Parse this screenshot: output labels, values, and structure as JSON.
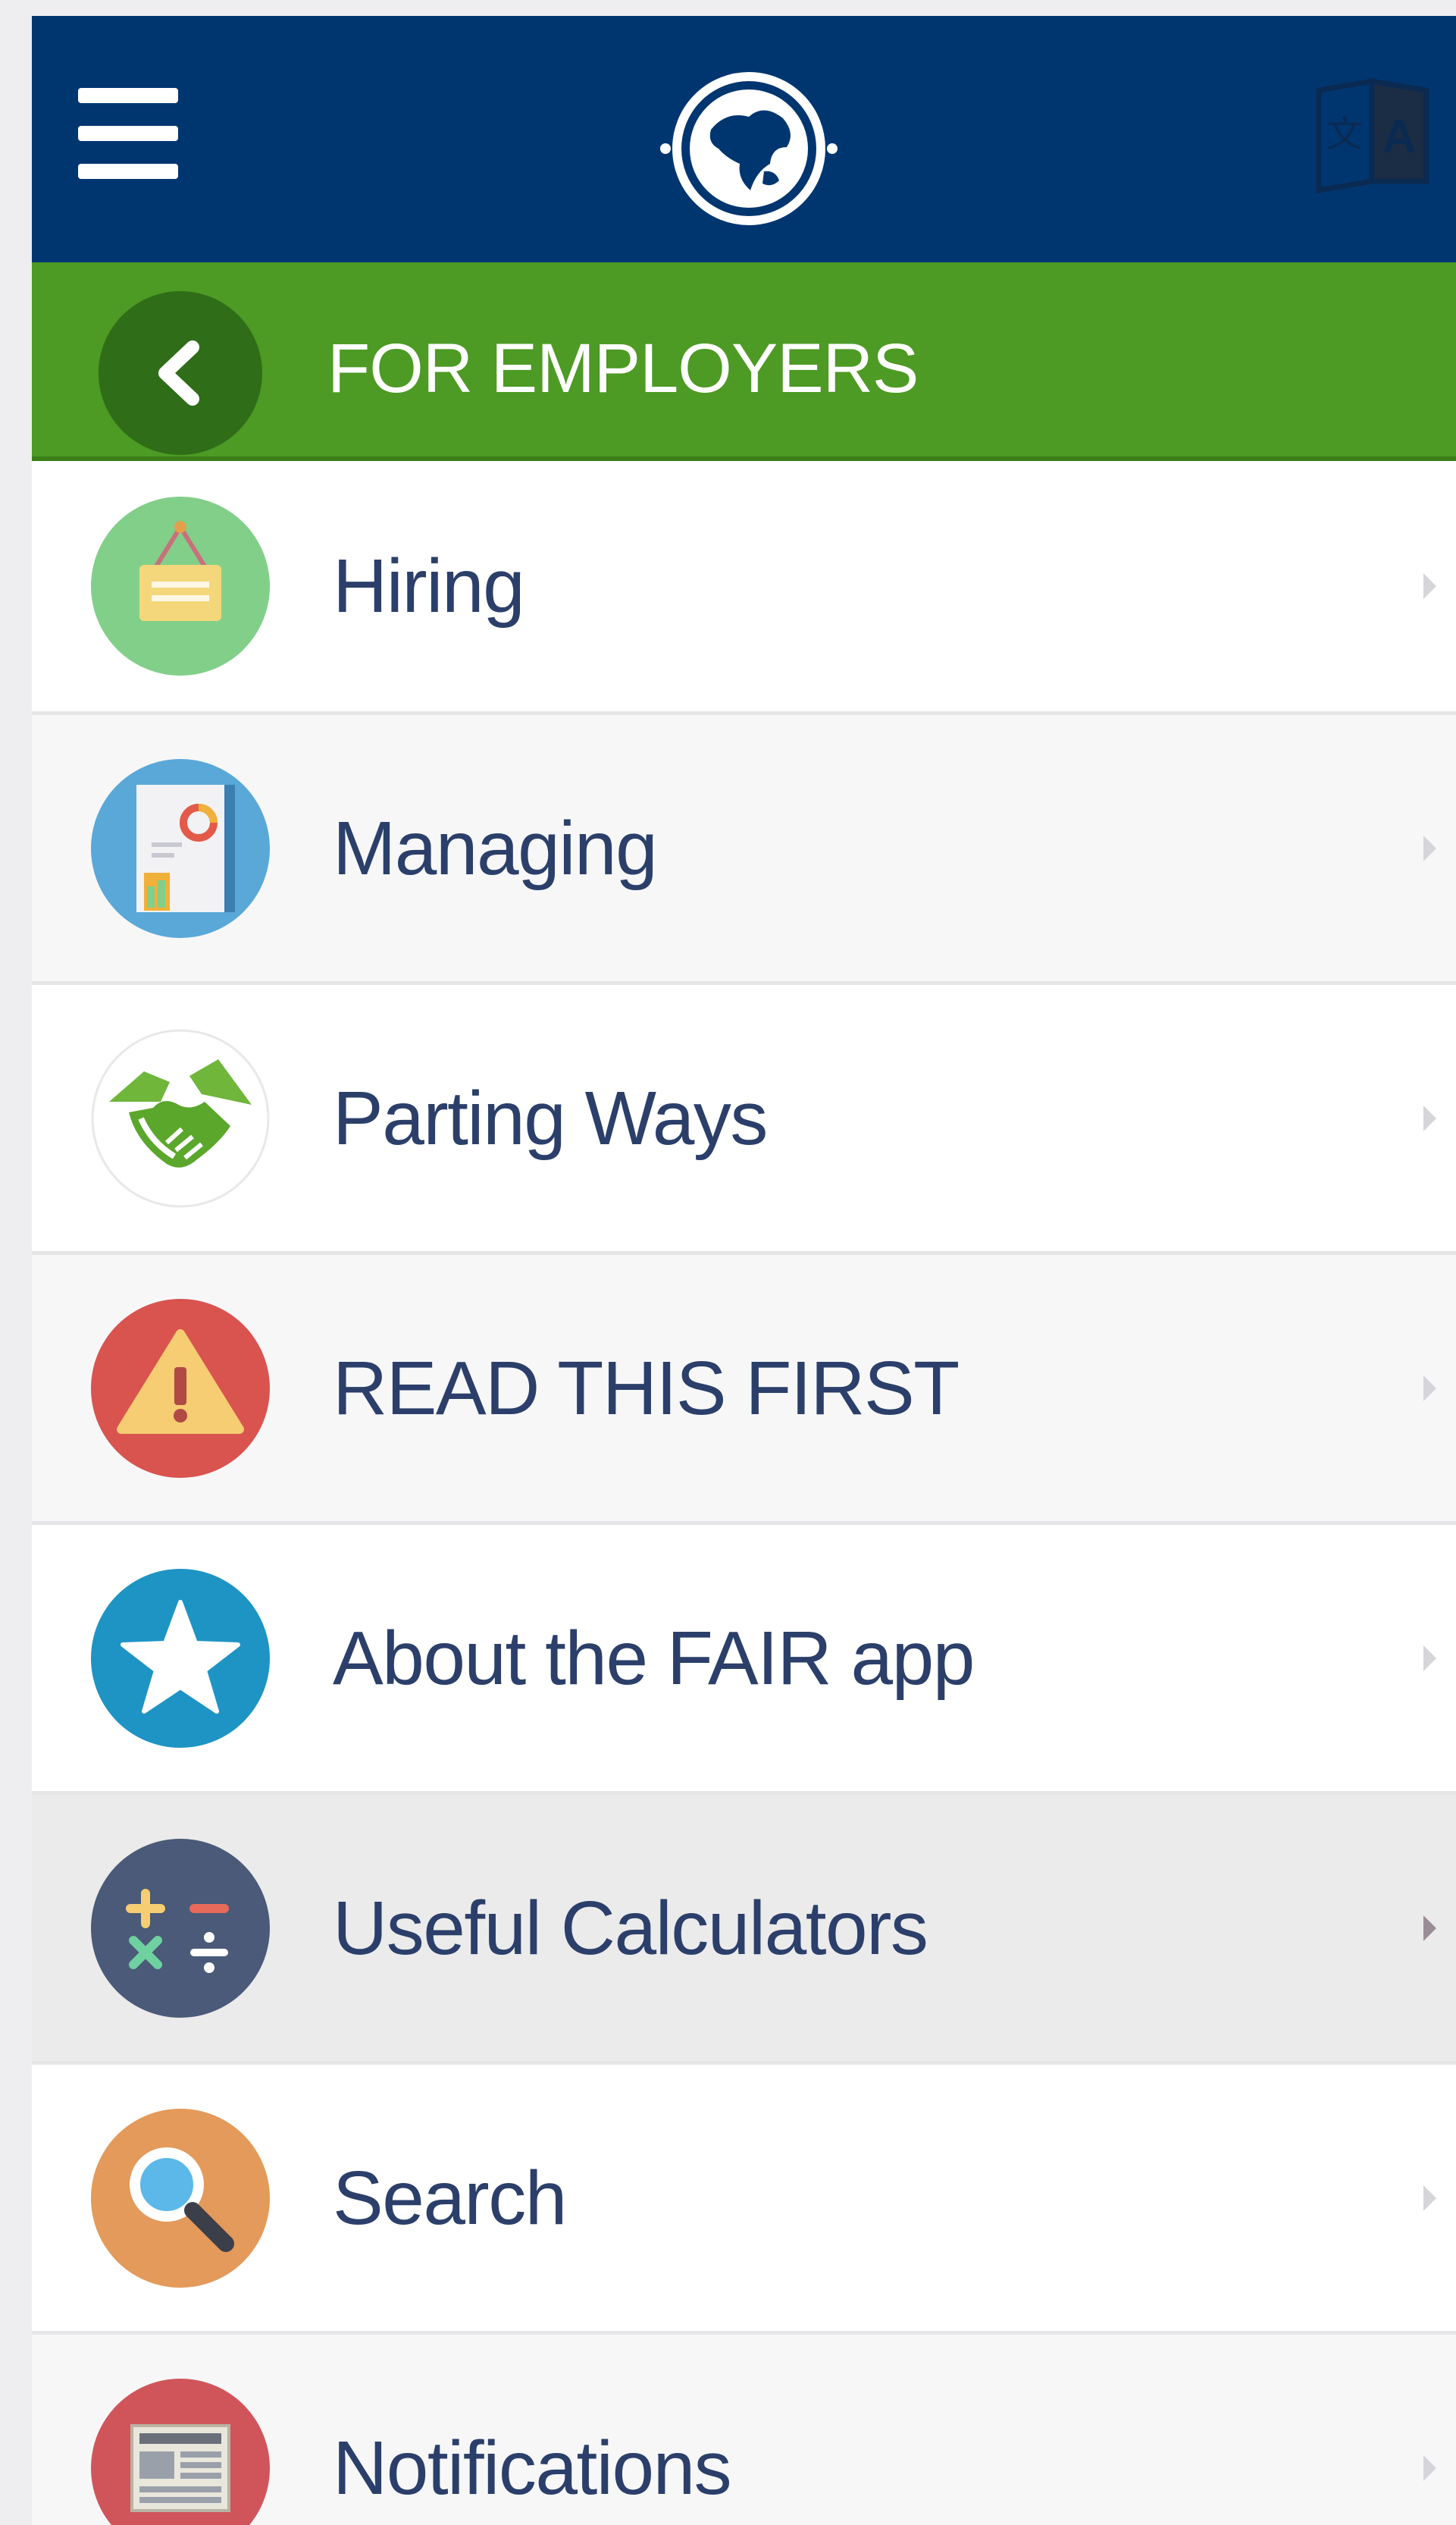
{
  "header": {
    "menu_icon": "hamburger-menu-icon",
    "logo_icon": "globe-logo-icon",
    "language_icon": "language-translate-icon"
  },
  "section": {
    "back_icon": "chevron-left-icon",
    "title": "FOR EMPLOYERS"
  },
  "menu": {
    "items": [
      {
        "label": "Hiring",
        "icon": "hiring-sign-icon",
        "color": "#82cf8a"
      },
      {
        "label": "Managing",
        "icon": "report-chart-icon",
        "color": "#5aa8d8"
      },
      {
        "label": "Parting Ways",
        "icon": "handshake-icon",
        "color": "#ffffff"
      },
      {
        "label": "READ THIS FIRST",
        "icon": "warning-icon",
        "color": "#d9534f"
      },
      {
        "label": "About the FAIR app",
        "icon": "star-icon",
        "color": "#1e94c4"
      },
      {
        "label": "Useful Calculators",
        "icon": "calculator-icon",
        "color": "#4a5a78",
        "active": true
      },
      {
        "label": "Search",
        "icon": "search-icon",
        "color": "#e39a5a"
      },
      {
        "label": "Notifications",
        "icon": "newspaper-icon",
        "color": "#d0555a"
      }
    ]
  },
  "colors": {
    "header_bg": "#003670",
    "section_bg": "#4d9a24",
    "label_text": "#2b3f6a"
  }
}
